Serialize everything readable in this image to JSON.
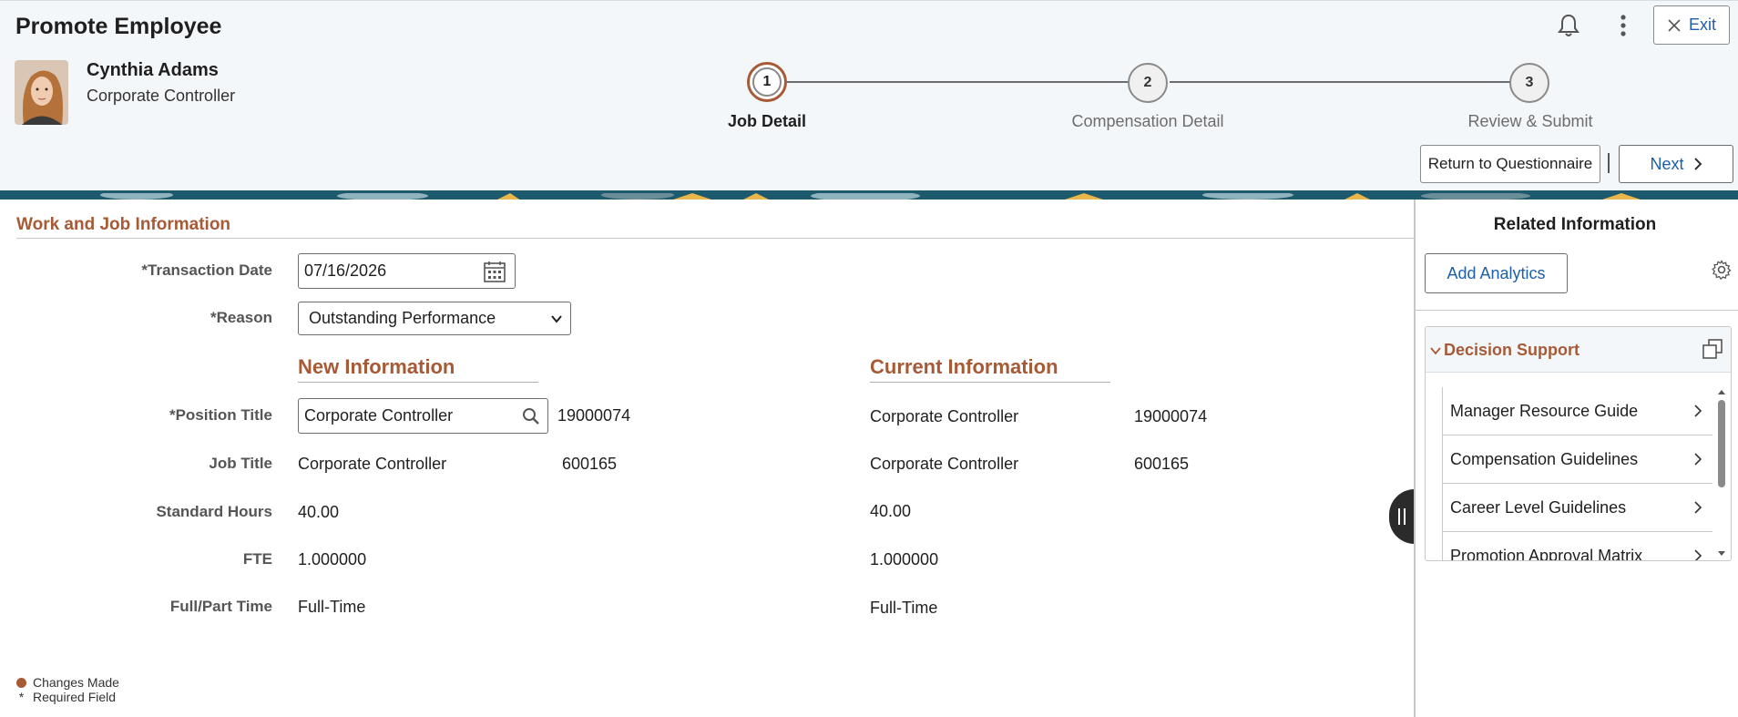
{
  "header": {
    "page_title": "Promote Employee",
    "exit_label": "Exit",
    "employee": {
      "name": "Cynthia Adams",
      "title": "Corporate Controller"
    },
    "steps": [
      {
        "number": "1",
        "label": "Job Detail",
        "active": true
      },
      {
        "number": "2",
        "label": "Compensation Detail",
        "active": false
      },
      {
        "number": "3",
        "label": "Review & Submit",
        "active": false
      }
    ],
    "return_label": "Return to Questionnaire",
    "next_label": "Next"
  },
  "main": {
    "section_title": "Work and Job Information",
    "transaction_date": {
      "label": "*Transaction Date",
      "value": "07/16/2026"
    },
    "reason": {
      "label": "*Reason",
      "value": "Outstanding Performance"
    },
    "new_info_heading": "New Information",
    "current_info_heading": "Current Information",
    "rows": {
      "position_title": {
        "label": "*Position Title",
        "new_value": "Corporate Controller",
        "new_code": "19000074",
        "current_value": "Corporate Controller",
        "current_code": "19000074"
      },
      "job_title": {
        "label": "Job Title",
        "new_value": "Corporate Controller",
        "new_code": "600165",
        "current_value": "Corporate Controller",
        "current_code": "600165"
      },
      "standard_hours": {
        "label": "Standard Hours",
        "new_value": "40.00",
        "current_value": "40.00"
      },
      "fte": {
        "label": "FTE",
        "new_value": "1.000000",
        "current_value": "1.000000"
      },
      "full_part_time": {
        "label": "Full/Part Time",
        "new_value": "Full-Time",
        "current_value": "Full-Time"
      }
    },
    "legend": {
      "changes_made": "Changes Made",
      "required_symbol": "*",
      "required_field": "Required Field"
    }
  },
  "related": {
    "title": "Related Information",
    "add_analytics_label": "Add Analytics",
    "decision_support": {
      "title": "Decision Support",
      "items": [
        "Manager Resource Guide",
        "Compensation Guidelines",
        "Career Level Guidelines",
        "Promotion Approval Matrix"
      ]
    }
  },
  "colors": {
    "accent": "#a65a35",
    "link": "#1f5fa8",
    "header_bg": "#f4f7fa"
  }
}
